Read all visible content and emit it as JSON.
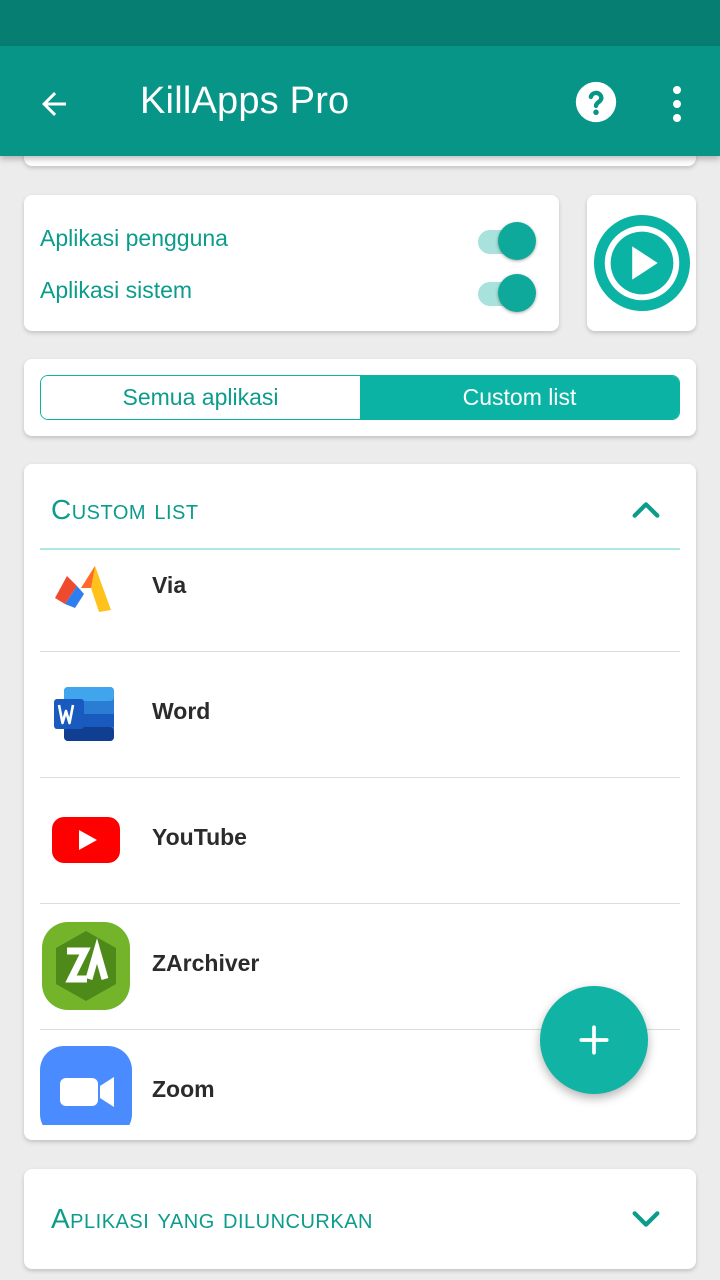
{
  "appbar": {
    "title": "KillApps Pro",
    "back_icon": "arrow-left-icon",
    "help_icon": "help-circle-icon",
    "more_icon": "more-vert-icon",
    "color": "#069587"
  },
  "options": {
    "user_apps_label": "Aplikasi pengguna",
    "user_apps_on": true,
    "system_apps_label": "Aplikasi sistem",
    "system_apps_on": true
  },
  "segment": {
    "all_label": "Semua aplikasi",
    "custom_label": "Custom list",
    "selected": "custom"
  },
  "custom_section": {
    "title": "Custom list",
    "expanded": true,
    "apps": [
      {
        "name": "Via",
        "icon": "via-icon"
      },
      {
        "name": "Word",
        "icon": "word-icon"
      },
      {
        "name": "YouTube",
        "icon": "youtube-icon"
      },
      {
        "name": "ZArchiver",
        "icon": "zarchiver-icon"
      },
      {
        "name": "Zoom",
        "icon": "zoom-icon"
      }
    ]
  },
  "launched_section": {
    "title": "Aplikasi yang diluncurkan",
    "expanded": false
  },
  "fab": {
    "icon": "plus-icon"
  },
  "colors": {
    "accent": "#0bb3a4",
    "text_accent": "#0b9c8c"
  }
}
